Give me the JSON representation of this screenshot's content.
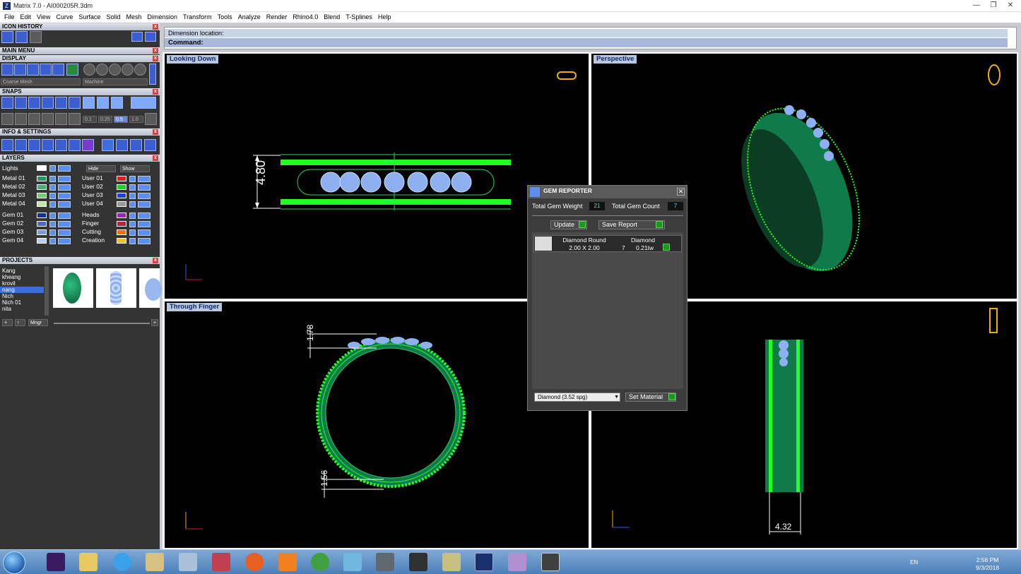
{
  "window": {
    "title": "Matrix 7.0 - AI000205R.3dm",
    "app_icon": "Z"
  },
  "menu": [
    "File",
    "Edit",
    "View",
    "Curve",
    "Surface",
    "Solid",
    "Mesh",
    "Dimension",
    "Transform",
    "Tools",
    "Analyze",
    "Render",
    "Rhino4.0",
    "Blend",
    "T-Splines",
    "Help"
  ],
  "left": {
    "icon_history": "ICON HISTORY",
    "main_menu": "MAIN MENU",
    "display": "DISPLAY",
    "display_mesh": "Coarse Mesh",
    "display_material": "Machine",
    "snaps": "SNAPS",
    "snap_values": [
      "0.1",
      "0.25",
      "0.5",
      "1.0"
    ],
    "info_settings": "INFO & SETTINGS",
    "layers": "LAYERS",
    "lights": "Lights",
    "hide": "Hide",
    "show": "Show",
    "layer_left": [
      {
        "name": "Metal 01",
        "color": "#1f9a60"
      },
      {
        "name": "Metal 02",
        "color": "#3fb070"
      },
      {
        "name": "Metal 03",
        "color": "#6fd06f"
      },
      {
        "name": "Metal 04",
        "color": "#bfe8a8"
      },
      {
        "name": "Gem 01",
        "color": "#1030a0"
      },
      {
        "name": "Gem 02",
        "color": "#4a6ad0"
      },
      {
        "name": "Gem 03",
        "color": "#7a9ae8"
      },
      {
        "name": "Gem 04",
        "color": "#b8ccf4"
      }
    ],
    "layer_right": [
      {
        "name": "User 01",
        "color": "#e02020"
      },
      {
        "name": "User 02",
        "color": "#20d020"
      },
      {
        "name": "User 03",
        "color": "#2040e0"
      },
      {
        "name": "User 04",
        "color": "#9a9a9a"
      },
      {
        "name": "Heads",
        "color": "#a020c0"
      },
      {
        "name": "Finger",
        "color": "#c02040"
      },
      {
        "name": "Cutting",
        "color": "#f07010"
      },
      {
        "name": "Creation",
        "color": "#f0c020"
      }
    ],
    "projects": "PROJECTS",
    "project_names": [
      "Kang",
      "kheang",
      "krovil",
      "nang",
      "Nich",
      "Nich 01",
      "nita"
    ],
    "project_selected": "nang",
    "thumbs": [
      "1",
      "2",
      "3"
    ],
    "mngr": "Mngr"
  },
  "command": {
    "line1": "Dimension location:",
    "line2": "Command:"
  },
  "viewports": {
    "top_left": "Looking Down",
    "top_right": "Perspective",
    "bottom_left": "Through Finger",
    "bottom_right": ""
  },
  "dims": {
    "width_top": "4.80",
    "top_thick": "1.78",
    "bottom_thick": "1.56",
    "side_width": "4.32"
  },
  "gem_reporter": {
    "title": "GEM REPORTER",
    "weight_label": "Total Gem Weight",
    "weight": "21",
    "count_label": "Total Gem Count",
    "count": "7",
    "update": "Update",
    "save_report": "Save Report",
    "row": {
      "shape": "Diamond Round",
      "size": "2.00 X 2.00",
      "material": "Diamond",
      "qty": "7",
      "tw": "0.21tw"
    },
    "material_select": "Diamond      (3.52 spg)",
    "set_material": "Set Material"
  },
  "taskbar": {
    "lang": "EN",
    "time": "2:56 PM",
    "date": "9/3/2018"
  },
  "colors": {
    "band": "#1fa060",
    "band_dark": "#0b5d38",
    "gem": "#8fb0f0",
    "accent": "#1a9a1a"
  }
}
